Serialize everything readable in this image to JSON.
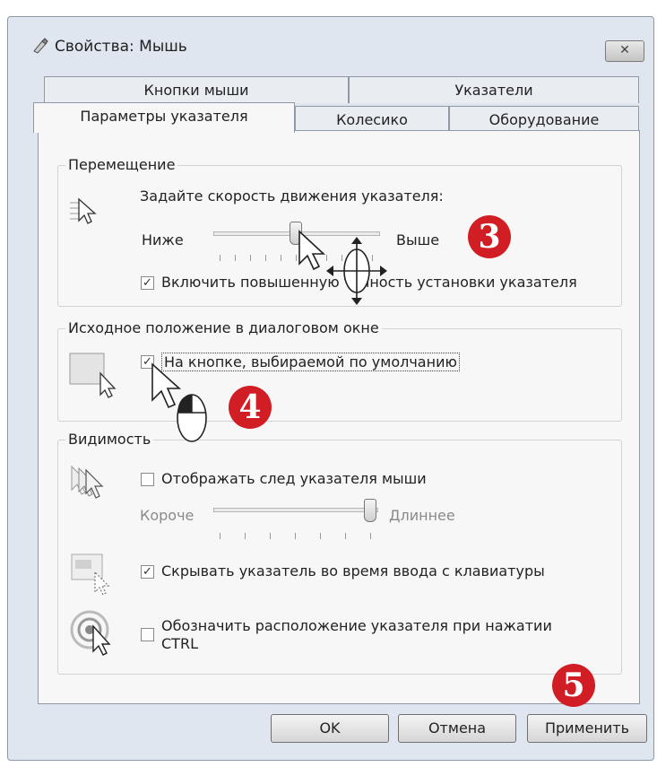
{
  "window": {
    "title": "Свойства: Мышь",
    "close_label": "✕"
  },
  "tabs": {
    "row_back": [
      "Кнопки мыши",
      "Указатели"
    ],
    "row_front": [
      "Параметры указателя",
      "Колесико",
      "Оборудование"
    ],
    "active": "Параметры указателя"
  },
  "motion": {
    "label": "Перемещение",
    "prompt": "Задайте скорость движения указателя:",
    "slow": "Ниже",
    "fast": "Выше",
    "speed_level": 0.5,
    "precision_checked": true,
    "precision_label": "Включить повышенную точность установки указателя"
  },
  "snap": {
    "label": "Исходное положение в диалоговом окне",
    "checked": true,
    "option_label": "На кнопке, выбираемой по умолчанию"
  },
  "visibility": {
    "label": "Видимость",
    "trails_checked": false,
    "trails_label": "Отображать след указателя мыши",
    "short": "Короче",
    "long": "Длиннее",
    "trail_level": 1.0,
    "hide_checked": true,
    "hide_label": "Скрывать указатель во время ввода с клавиатуры",
    "ctrl_checked": false,
    "ctrl_label_line1": "Обозначить расположение указателя при нажатии",
    "ctrl_label_line2": "CTRL"
  },
  "badges": [
    "3",
    "4",
    "5"
  ],
  "buttons": {
    "ok": "OK",
    "cancel": "Отмена",
    "apply": "Применить"
  },
  "colors": {
    "badge": "#d11d24",
    "window_bg": "#dfe6ef"
  }
}
